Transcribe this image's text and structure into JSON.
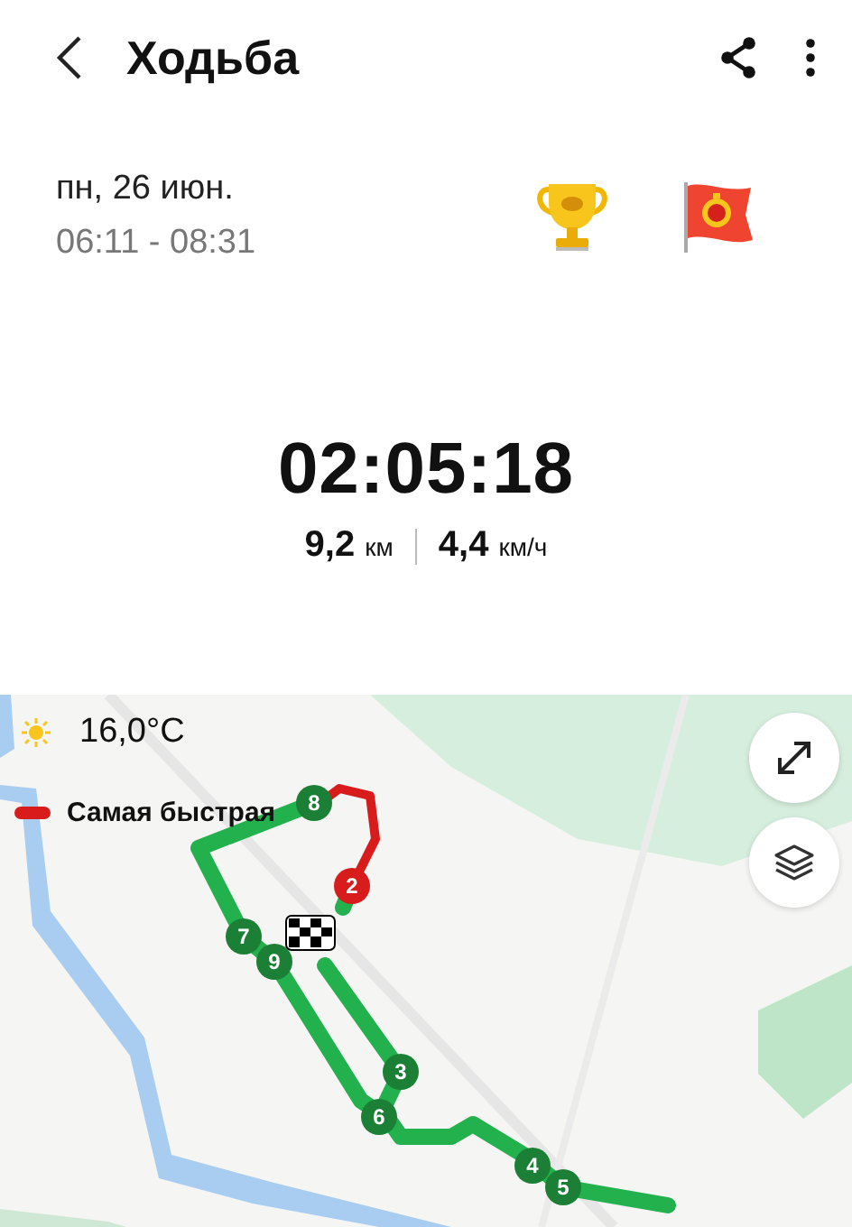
{
  "header": {
    "title": "Ходьба"
  },
  "workout": {
    "date": "пн, 26 июн.",
    "time_range": "06:11 - 08:31"
  },
  "stats": {
    "duration": "02:05:18",
    "distance": {
      "value": "9,2",
      "unit": "км"
    },
    "speed": {
      "value": "4,4",
      "unit": "км/ч"
    }
  },
  "map": {
    "temperature": "16,0°C",
    "legend": {
      "label": "Самая быстрая",
      "color": "#d81b1b"
    },
    "markers": [
      {
        "label": "8",
        "color": "#1b7f35"
      },
      {
        "label": "2",
        "color": "#d81b1b"
      },
      {
        "label": "7",
        "color": "#1b7f35"
      },
      {
        "label": "9",
        "color": "#1b7f35"
      },
      {
        "label": "3",
        "color": "#1b7f35"
      },
      {
        "label": "6",
        "color": "#1b7f35"
      },
      {
        "label": "4",
        "color": "#1b7f35"
      },
      {
        "label": "5",
        "color": "#1b7f35"
      }
    ]
  }
}
